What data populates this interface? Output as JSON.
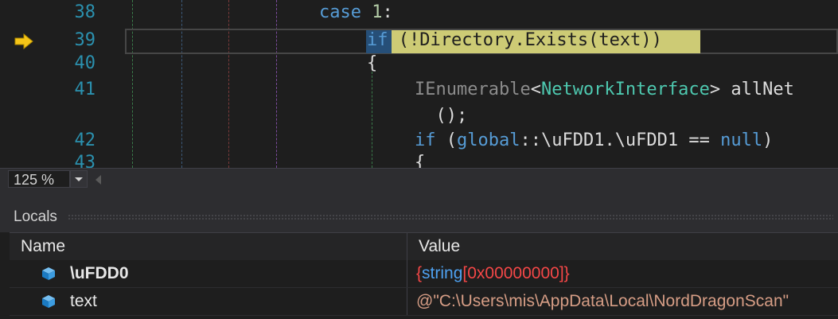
{
  "editor": {
    "lines": [
      {
        "num": "38"
      },
      {
        "num": "39"
      },
      {
        "num": "40"
      },
      {
        "num": "41"
      },
      {
        "num": "42"
      },
      {
        "num": "43"
      }
    ],
    "code": {
      "l38_kw": "case",
      "l38_num": "1",
      "l38_colon": ":",
      "l39_kw": "if",
      "l39_rest": " (!Directory.Exists(text))",
      "l40": "{",
      "l41_type1": "IEnumerable",
      "l41_lt": "<",
      "l41_type2": "NetworkInterface",
      "l41_rest": "> allNet",
      "l41b": "  ();",
      "l42_kw": "if",
      "l42_a": " (",
      "l42_global": "global",
      "l42_b": "::\\uFDD1.\\uFDD1 == ",
      "l42_null": "null",
      "l42_c": ")",
      "l43": "{"
    }
  },
  "zoom": {
    "value": "125 %"
  },
  "locals": {
    "title": "Locals",
    "columns": {
      "name": "Name",
      "value": "Value"
    },
    "rows": [
      {
        "name": "\\uFDD0",
        "value_open": "{",
        "value_type": "string",
        "value_body": "[0x00000000]",
        "value_close": "}"
      },
      {
        "name": "text",
        "value": "@\"C:\\Users\\mis\\AppData\\Local\\NordDragonScan\""
      }
    ]
  },
  "colors": {
    "keyword": "#569cd6",
    "type": "#4ec9b0",
    "line_number": "#2b91af",
    "exec_highlight": "#cdcb75",
    "string_value": "#d69d85"
  },
  "icons": [
    "execution-arrow-icon",
    "variable-cube-icon"
  ]
}
